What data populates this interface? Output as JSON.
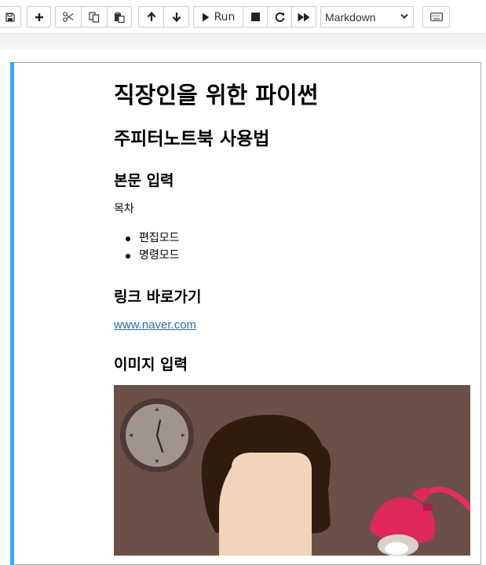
{
  "toolbar": {
    "buttons": [
      {
        "name": "save-button",
        "icon": "save-icon"
      },
      {
        "name": "insert-cell-button",
        "icon": "plus-icon"
      },
      {
        "name": "cut-button",
        "icon": "scissors-icon"
      },
      {
        "name": "copy-button",
        "icon": "copy-icon"
      },
      {
        "name": "paste-button",
        "icon": "paste-icon"
      },
      {
        "name": "move-up-button",
        "icon": "arrow-up-icon"
      },
      {
        "name": "move-down-button",
        "icon": "arrow-down-icon"
      },
      {
        "name": "run-button",
        "icon": "play-icon"
      },
      {
        "name": "stop-button",
        "icon": "stop-icon"
      },
      {
        "name": "restart-button",
        "icon": "refresh-icon"
      },
      {
        "name": "run-all-button",
        "icon": "fast-forward-icon"
      },
      {
        "name": "keyboard-button",
        "icon": "keyboard-icon"
      }
    ],
    "run_label": "Run",
    "cell_type": "Markdown"
  },
  "cell": {
    "h1": "직장인을 위한 파이썬",
    "h2": "주피터노트북 사용법",
    "section1_title": "본문 입력",
    "paragraph": "목차",
    "list_items": [
      "편집모드",
      "명령모드"
    ],
    "section2_title": "링크 바로가기",
    "link_text": "www.naver.com",
    "section3_title": "이미지 입력"
  },
  "colors": {
    "cell_selected_bar": "#42a5f5",
    "link": "#296eaa",
    "image_background": "#6b5048"
  }
}
